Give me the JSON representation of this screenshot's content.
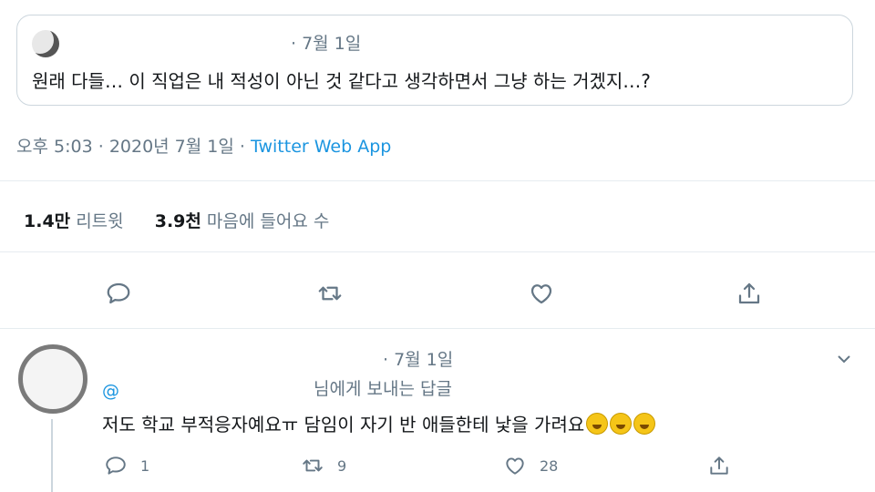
{
  "quoted_tweet": {
    "date": "· 7월 1일",
    "text": "원래 다들… 이 직업은 내 적성이 아닌 것 같다고 생각하면서 그냥 하는 거겠지…?"
  },
  "tweet_meta": {
    "time": "오후 5:03",
    "date": "2020년 7월 1일",
    "source": "Twitter Web App"
  },
  "stats": {
    "retweets_count": "1.4만",
    "retweets_label": "리트윗",
    "likes_count": "3.9천",
    "likes_label": "마음에 들어요 수"
  },
  "actions": {
    "icons": [
      "reply-icon",
      "retweet-icon",
      "like-icon",
      "share-icon"
    ]
  },
  "reply": {
    "date": "· 7월 1일",
    "handle": "@",
    "replying_to": "님에게 보내는 답글",
    "text": "저도 학교 부적응자예요ㅠ 담임이 자기 반 애들한테 낯을 가려요",
    "emoji": [
      "rofl-emoji",
      "rofl-emoji",
      "rofl-emoji"
    ],
    "reply_count": "1",
    "retweet_count": "9",
    "like_count": "28"
  },
  "colors": {
    "link": "#1b95e0",
    "muted": "#657786",
    "border": "#ccd6dd"
  }
}
